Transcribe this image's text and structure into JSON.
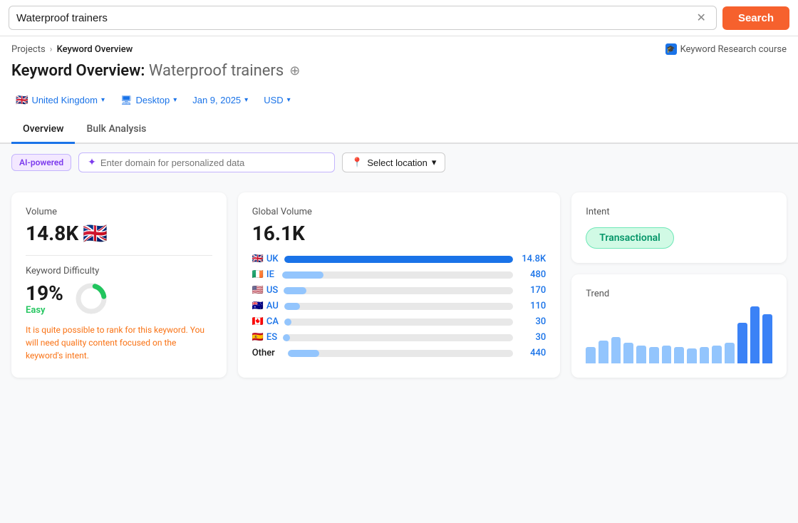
{
  "search": {
    "value": "Waterproof trainers",
    "placeholder": "Waterproof trainers",
    "button_label": "Search",
    "clear_title": "Clear"
  },
  "breadcrumb": {
    "projects_label": "Projects",
    "current_label": "Keyword Overview",
    "course_label": "Keyword Research course"
  },
  "page_title": {
    "prefix": "Keyword Overview:",
    "keyword": "Waterproof trainers",
    "add_title": "Add to list"
  },
  "filters": {
    "location": "United Kingdom",
    "device": "Desktop",
    "date": "Jan 9, 2025",
    "currency": "USD"
  },
  "tabs": {
    "items": [
      {
        "label": "Overview",
        "active": true
      },
      {
        "label": "Bulk Analysis",
        "active": false
      }
    ]
  },
  "ai_bar": {
    "badge_label": "AI-powered",
    "input_placeholder": "Enter domain for personalized data",
    "location_label": "Select location"
  },
  "volume_card": {
    "label": "Volume",
    "value": "14.8K",
    "flag": "🇬🇧"
  },
  "kd_card": {
    "label": "Keyword Difficulty",
    "value": "19%",
    "difficulty_label": "Easy",
    "description": "It is quite possible to rank for this keyword. You will need quality content focused on the keyword's intent.",
    "percentage": 19
  },
  "global_volume_card": {
    "label": "Global Volume",
    "value": "16.1K",
    "bars": [
      {
        "country": "UK",
        "flag": "🇬🇧",
        "value": "14.8K",
        "pct": 100
      },
      {
        "country": "IE",
        "flag": "🇮🇪",
        "value": "480",
        "pct": 18
      },
      {
        "country": "US",
        "flag": "🇺🇸",
        "value": "170",
        "pct": 10
      },
      {
        "country": "AU",
        "flag": "🇦🇺",
        "value": "110",
        "pct": 7
      },
      {
        "country": "CA",
        "flag": "🇨🇦",
        "value": "30",
        "pct": 3
      },
      {
        "country": "ES",
        "flag": "🇪🇸",
        "value": "30",
        "pct": 3
      },
      {
        "country": "Other",
        "flag": "",
        "value": "440",
        "pct": 14
      }
    ]
  },
  "intent_card": {
    "label": "Intent",
    "value": "Transactional"
  },
  "trend_card": {
    "label": "Trend",
    "bars": [
      20,
      28,
      32,
      25,
      22,
      20,
      22,
      20,
      18,
      20,
      22,
      25,
      50,
      70,
      60
    ]
  }
}
